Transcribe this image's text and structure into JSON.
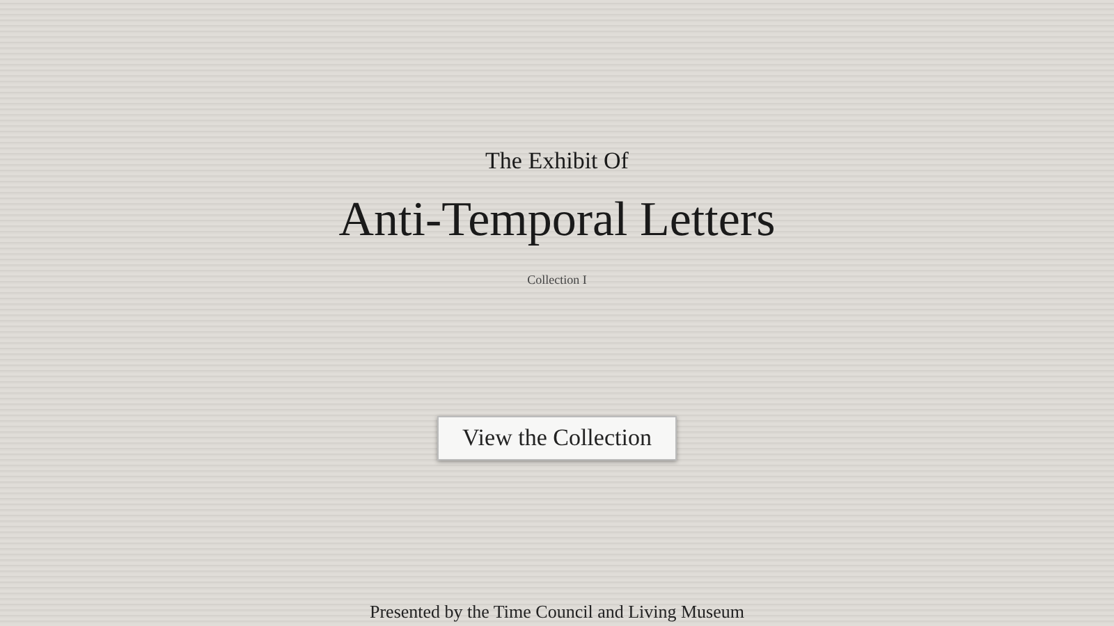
{
  "overline": "The Exhibit Of",
  "title": "Anti-Temporal Letters",
  "subtitle": "Collection I",
  "button": "View the Collection",
  "footer": "Presented by the Time Council and Living Museum"
}
